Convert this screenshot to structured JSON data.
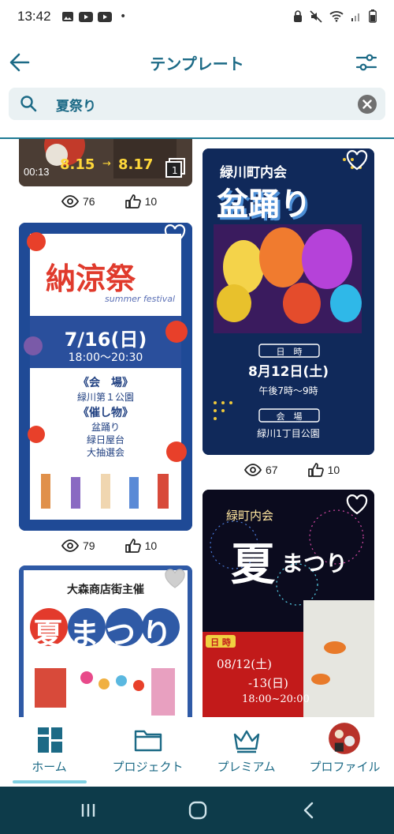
{
  "status_bar": {
    "time": "13:42",
    "dot": "•"
  },
  "header": {
    "title": "テンプレート"
  },
  "search": {
    "value": "夏祭り"
  },
  "cards": {
    "top_left": {
      "duration": "00:13",
      "date_from": "8.15",
      "date_to": "8.17"
    },
    "bon": {
      "org": "緑川町内会",
      "title": "盆踊り",
      "label_date": "日　時",
      "date": "8月12日(土)",
      "time": "午後7時〜9時",
      "label_place": "会　場",
      "place": "緑川1丁目公園"
    },
    "noryo": {
      "title": "納涼祭",
      "subtitle": "summer festival",
      "date": "7/16(日)",
      "time": "18:00〜20:30",
      "place_label": "《会　場》",
      "place": "緑川第１公園",
      "events_label": "《催し物》",
      "event1": "盆踊り",
      "event2": "緑日屋台",
      "event3": "大抽選会"
    },
    "omori": {
      "host": "大森商店街主催",
      "title": "夏まつり"
    },
    "natsu": {
      "org": "緑町内会",
      "title_big": "夏",
      "title_small": "まつり",
      "label": "日 時",
      "date": "08/12(土)",
      "date2": "-13(日)",
      "time": "18:00~20:00"
    }
  },
  "stats": {
    "top_left": {
      "views": "76",
      "likes": "10"
    },
    "bon": {
      "views": "67",
      "likes": "10"
    },
    "noryo": {
      "views": "79",
      "likes": "10"
    }
  },
  "nav": {
    "home": "ホーム",
    "projects": "プロジェクト",
    "premium": "プレミアム",
    "profile": "プロファイル"
  },
  "colors": {
    "primary": "#1c6a86",
    "indicator": "#7fd0e2",
    "system_nav": "#0d3b4a"
  }
}
